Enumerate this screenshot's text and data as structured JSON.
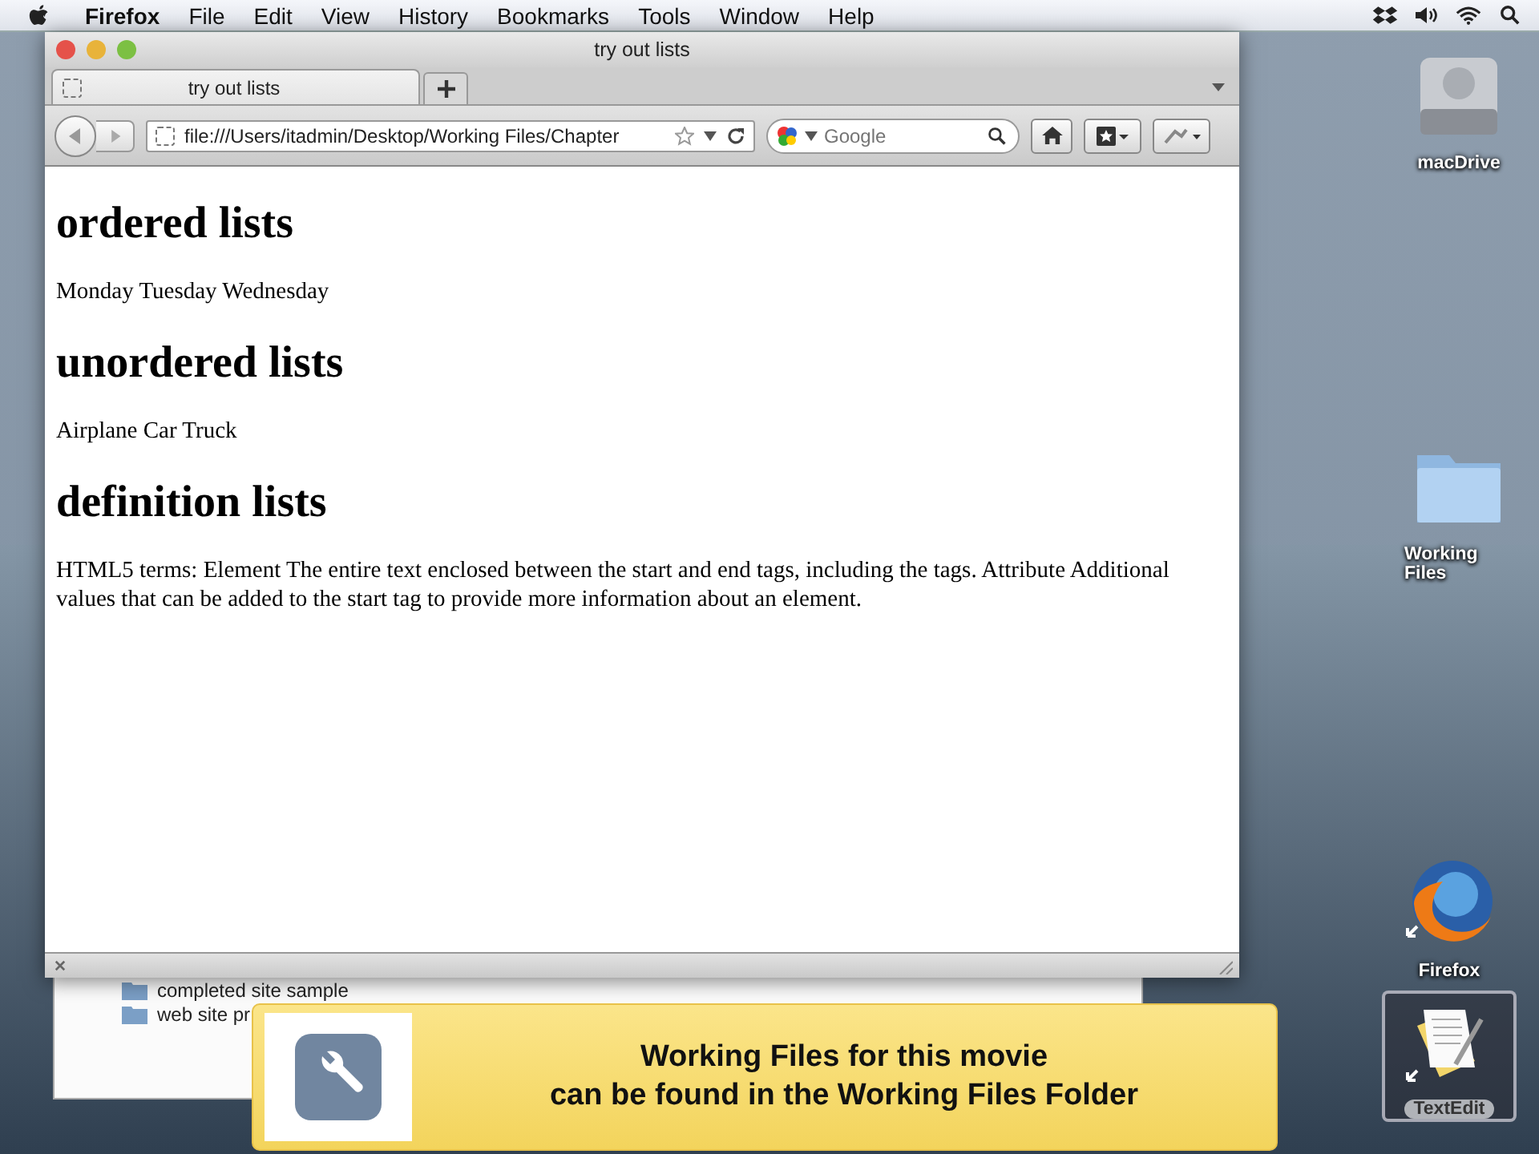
{
  "menu_bar": {
    "app_name": "Firefox",
    "items": [
      "File",
      "Edit",
      "View",
      "History",
      "Bookmarks",
      "Tools",
      "Window",
      "Help"
    ]
  },
  "browser": {
    "title": "try out lists",
    "tabs": [
      {
        "label": "try out lists",
        "selected": true
      }
    ],
    "address": "file:///Users/itadmin/Desktop/Working Files/Chapter",
    "search": {
      "placeholder": "Google"
    },
    "sections": [
      {
        "heading": "ordered lists",
        "text": "Monday Tuesday Wednesday"
      },
      {
        "heading": "unordered lists",
        "text": "Airplane Car Truck"
      },
      {
        "heading": "definition lists",
        "text": "HTML5 terms: Element The entire text enclosed between the start and end tags, including the tags. Attribute Additional values that can be added to the start tag to provide more information about an element."
      }
    ]
  },
  "background_window": {
    "items": [
      "completed site sample",
      "web site pr"
    ]
  },
  "notice": {
    "lines": [
      "Working Files for this movie",
      "can be found in the Working Files Folder"
    ]
  },
  "desktop_icons": [
    {
      "label": "macDrive",
      "kind": "drive",
      "selected": false
    },
    {
      "label": "Working Files",
      "kind": "folder",
      "selected": false
    },
    {
      "label": "Firefox",
      "kind": "app",
      "selected": false
    },
    {
      "label": "TextEdit",
      "kind": "document",
      "selected": true
    }
  ]
}
